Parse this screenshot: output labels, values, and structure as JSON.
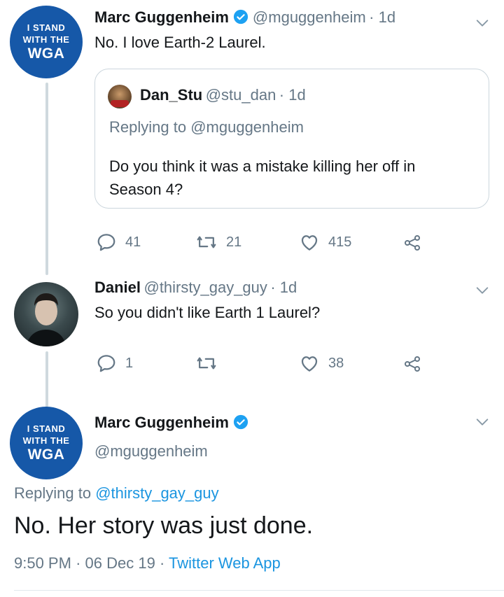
{
  "tweet1": {
    "avatar": {
      "line1": "I STAND",
      "line2": "WITH THE",
      "line3": "WGA"
    },
    "name": "Marc Guggenheim",
    "handle": "@mguggenheim",
    "time": "· 1d",
    "text": "No. I love Earth-2 Laurel.",
    "quote": {
      "name": "Dan_Stu",
      "handle": "@stu_dan",
      "time": "· 1d",
      "replying_prefix": "Replying to",
      "replying_to": "@mguggenheim",
      "text_line1": "Do you think it was a mistake killing her off in",
      "text_line2": "Season 4?"
    },
    "actions": {
      "replies": "41",
      "retweets": "21",
      "likes": "415"
    }
  },
  "tweet2": {
    "name": "Daniel",
    "handle": "@thirsty_gay_guy",
    "time": "· 1d",
    "text": "So you didn't like Earth 1 Laurel?",
    "actions": {
      "replies": "1",
      "retweets": "",
      "likes": "38"
    }
  },
  "main": {
    "avatar": {
      "line1": "I STAND",
      "line2": "WITH THE",
      "line3": "WGA"
    },
    "name": "Marc Guggenheim",
    "handle": "@mguggenheim",
    "replying_prefix": "Replying to",
    "replying_to": "@thirsty_gay_guy",
    "text": "No. Her story was just done.",
    "time": "9:50 PM",
    "date": "06 Dec 19",
    "source": "Twitter Web App"
  },
  "colors": {
    "accent": "#1b95e0",
    "muted": "#657786",
    "wga_blue": "#1658a8"
  },
  "icons": [
    "verified-icon",
    "chevron-down-icon",
    "reply-icon",
    "retweet-icon",
    "like-icon",
    "share-icon"
  ]
}
